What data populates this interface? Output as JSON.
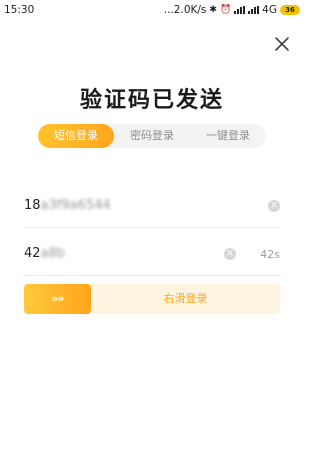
{
  "status_bar": {
    "time": "15:30",
    "net_speed": "...2.0K/s",
    "network": "4G",
    "battery": "36",
    "icons": [
      "bluetooth-icon",
      "alarm-icon",
      "signal-icon",
      "signal-icon"
    ]
  },
  "title": "验证码已发送",
  "tabs": [
    {
      "label": "短信登录",
      "active": true
    },
    {
      "label": "密码登录",
      "active": false
    },
    {
      "label": "一键登录",
      "active": false
    }
  ],
  "phone": {
    "prefix": "18",
    "masked": "a3f9a6544"
  },
  "code": {
    "prefix": "42",
    "masked": "a8b",
    "countdown": "42s"
  },
  "slider": {
    "handle": "»»",
    "label": "右滑登录"
  },
  "colors": {
    "accent": "#ffa51c",
    "accent_light": "#fff4df",
    "tab_bg": "#f3f3f3"
  }
}
